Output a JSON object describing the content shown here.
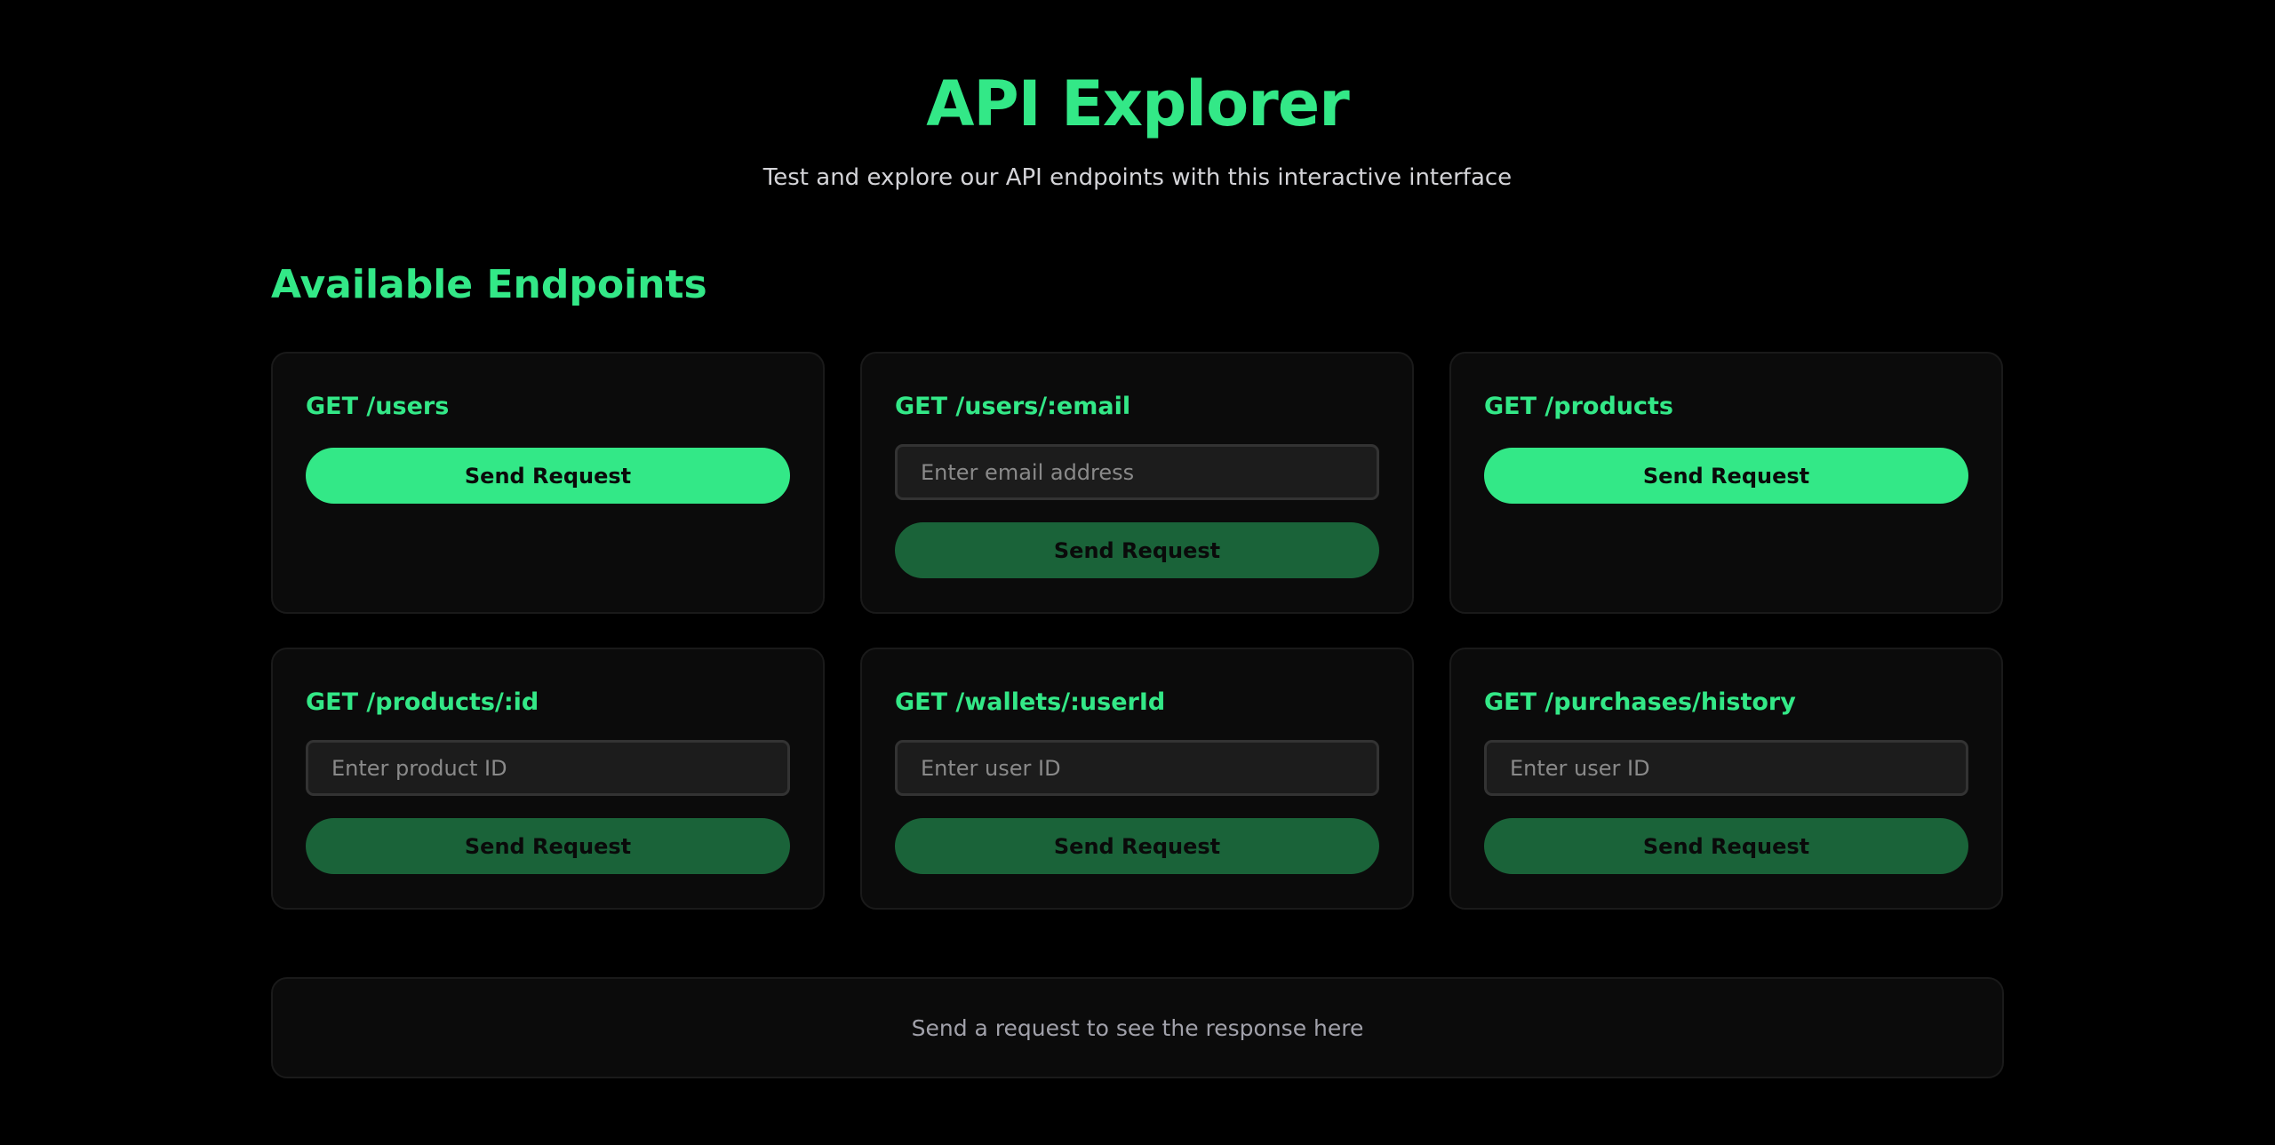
{
  "header": {
    "title": "API Explorer",
    "subtitle": "Test and explore our API endpoints with this interactive interface"
  },
  "endpoints_section": {
    "title": "Available Endpoints",
    "cards": [
      {
        "title": "GET /users",
        "button_label": "Send Request"
      },
      {
        "title": "GET /users/:email",
        "input_placeholder": "Enter email address",
        "input_value": "",
        "button_label": "Send Request"
      },
      {
        "title": "GET /products",
        "button_label": "Send Request"
      },
      {
        "title": "GET /products/:id",
        "input_placeholder": "Enter product ID",
        "input_value": "",
        "button_label": "Send Request"
      },
      {
        "title": "GET /wallets/:userId",
        "input_placeholder": "Enter user ID",
        "input_value": "",
        "button_label": "Send Request"
      },
      {
        "title": "GET /purchases/history",
        "input_placeholder": "Enter user ID",
        "input_value": "",
        "button_label": "Send Request"
      }
    ]
  },
  "response": {
    "placeholder": "Send a request to see the response here"
  },
  "colors": {
    "accent": "#33e887",
    "accent_disabled": "#1a6339",
    "background": "#000000",
    "card_background": "#0b0b0b"
  }
}
